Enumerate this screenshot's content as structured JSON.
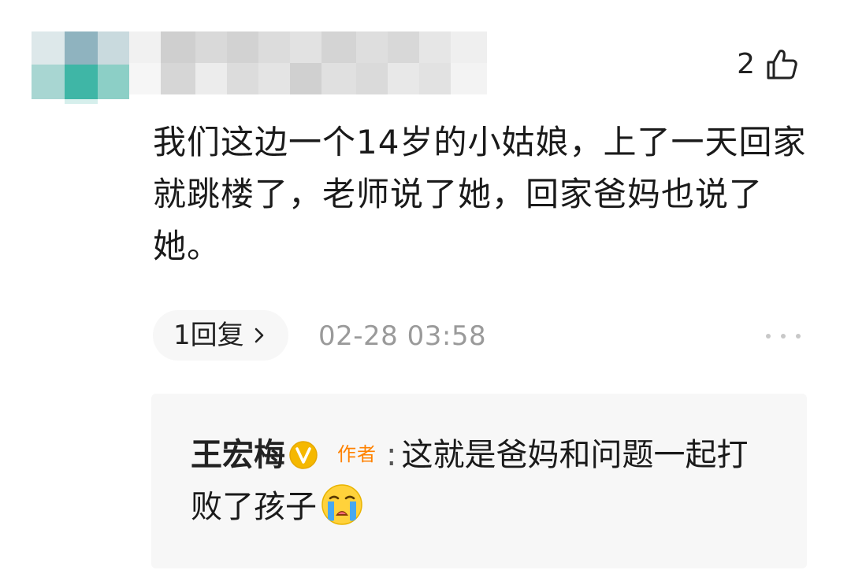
{
  "comment": {
    "like_count": "2",
    "text": "我们这边一个14岁的小姑娘，上了一天回家就跳楼了，老师说了她，回家爸妈也说了她。",
    "reply_label": "1回复",
    "timestamp": "02-28 03:58"
  },
  "author_reply": {
    "author_name": "王宏梅",
    "author_badge": "作者",
    "separator": ":",
    "text": "这就是爸妈和问题一起打败了孩子"
  },
  "icons": {
    "like": "thumbs-up-icon",
    "reply_arrow": "chevron-right-icon",
    "more": "more-dots-icon",
    "verified": "verified-v-icon",
    "emoji": "crying-emoji-icon"
  },
  "colors": {
    "text_primary": "#1a1a1a",
    "timestamp": "#9a9a9a",
    "author_badge": "#ff8200",
    "verified_badge": "#f5b800",
    "reply_background": "#f7f7f7"
  }
}
